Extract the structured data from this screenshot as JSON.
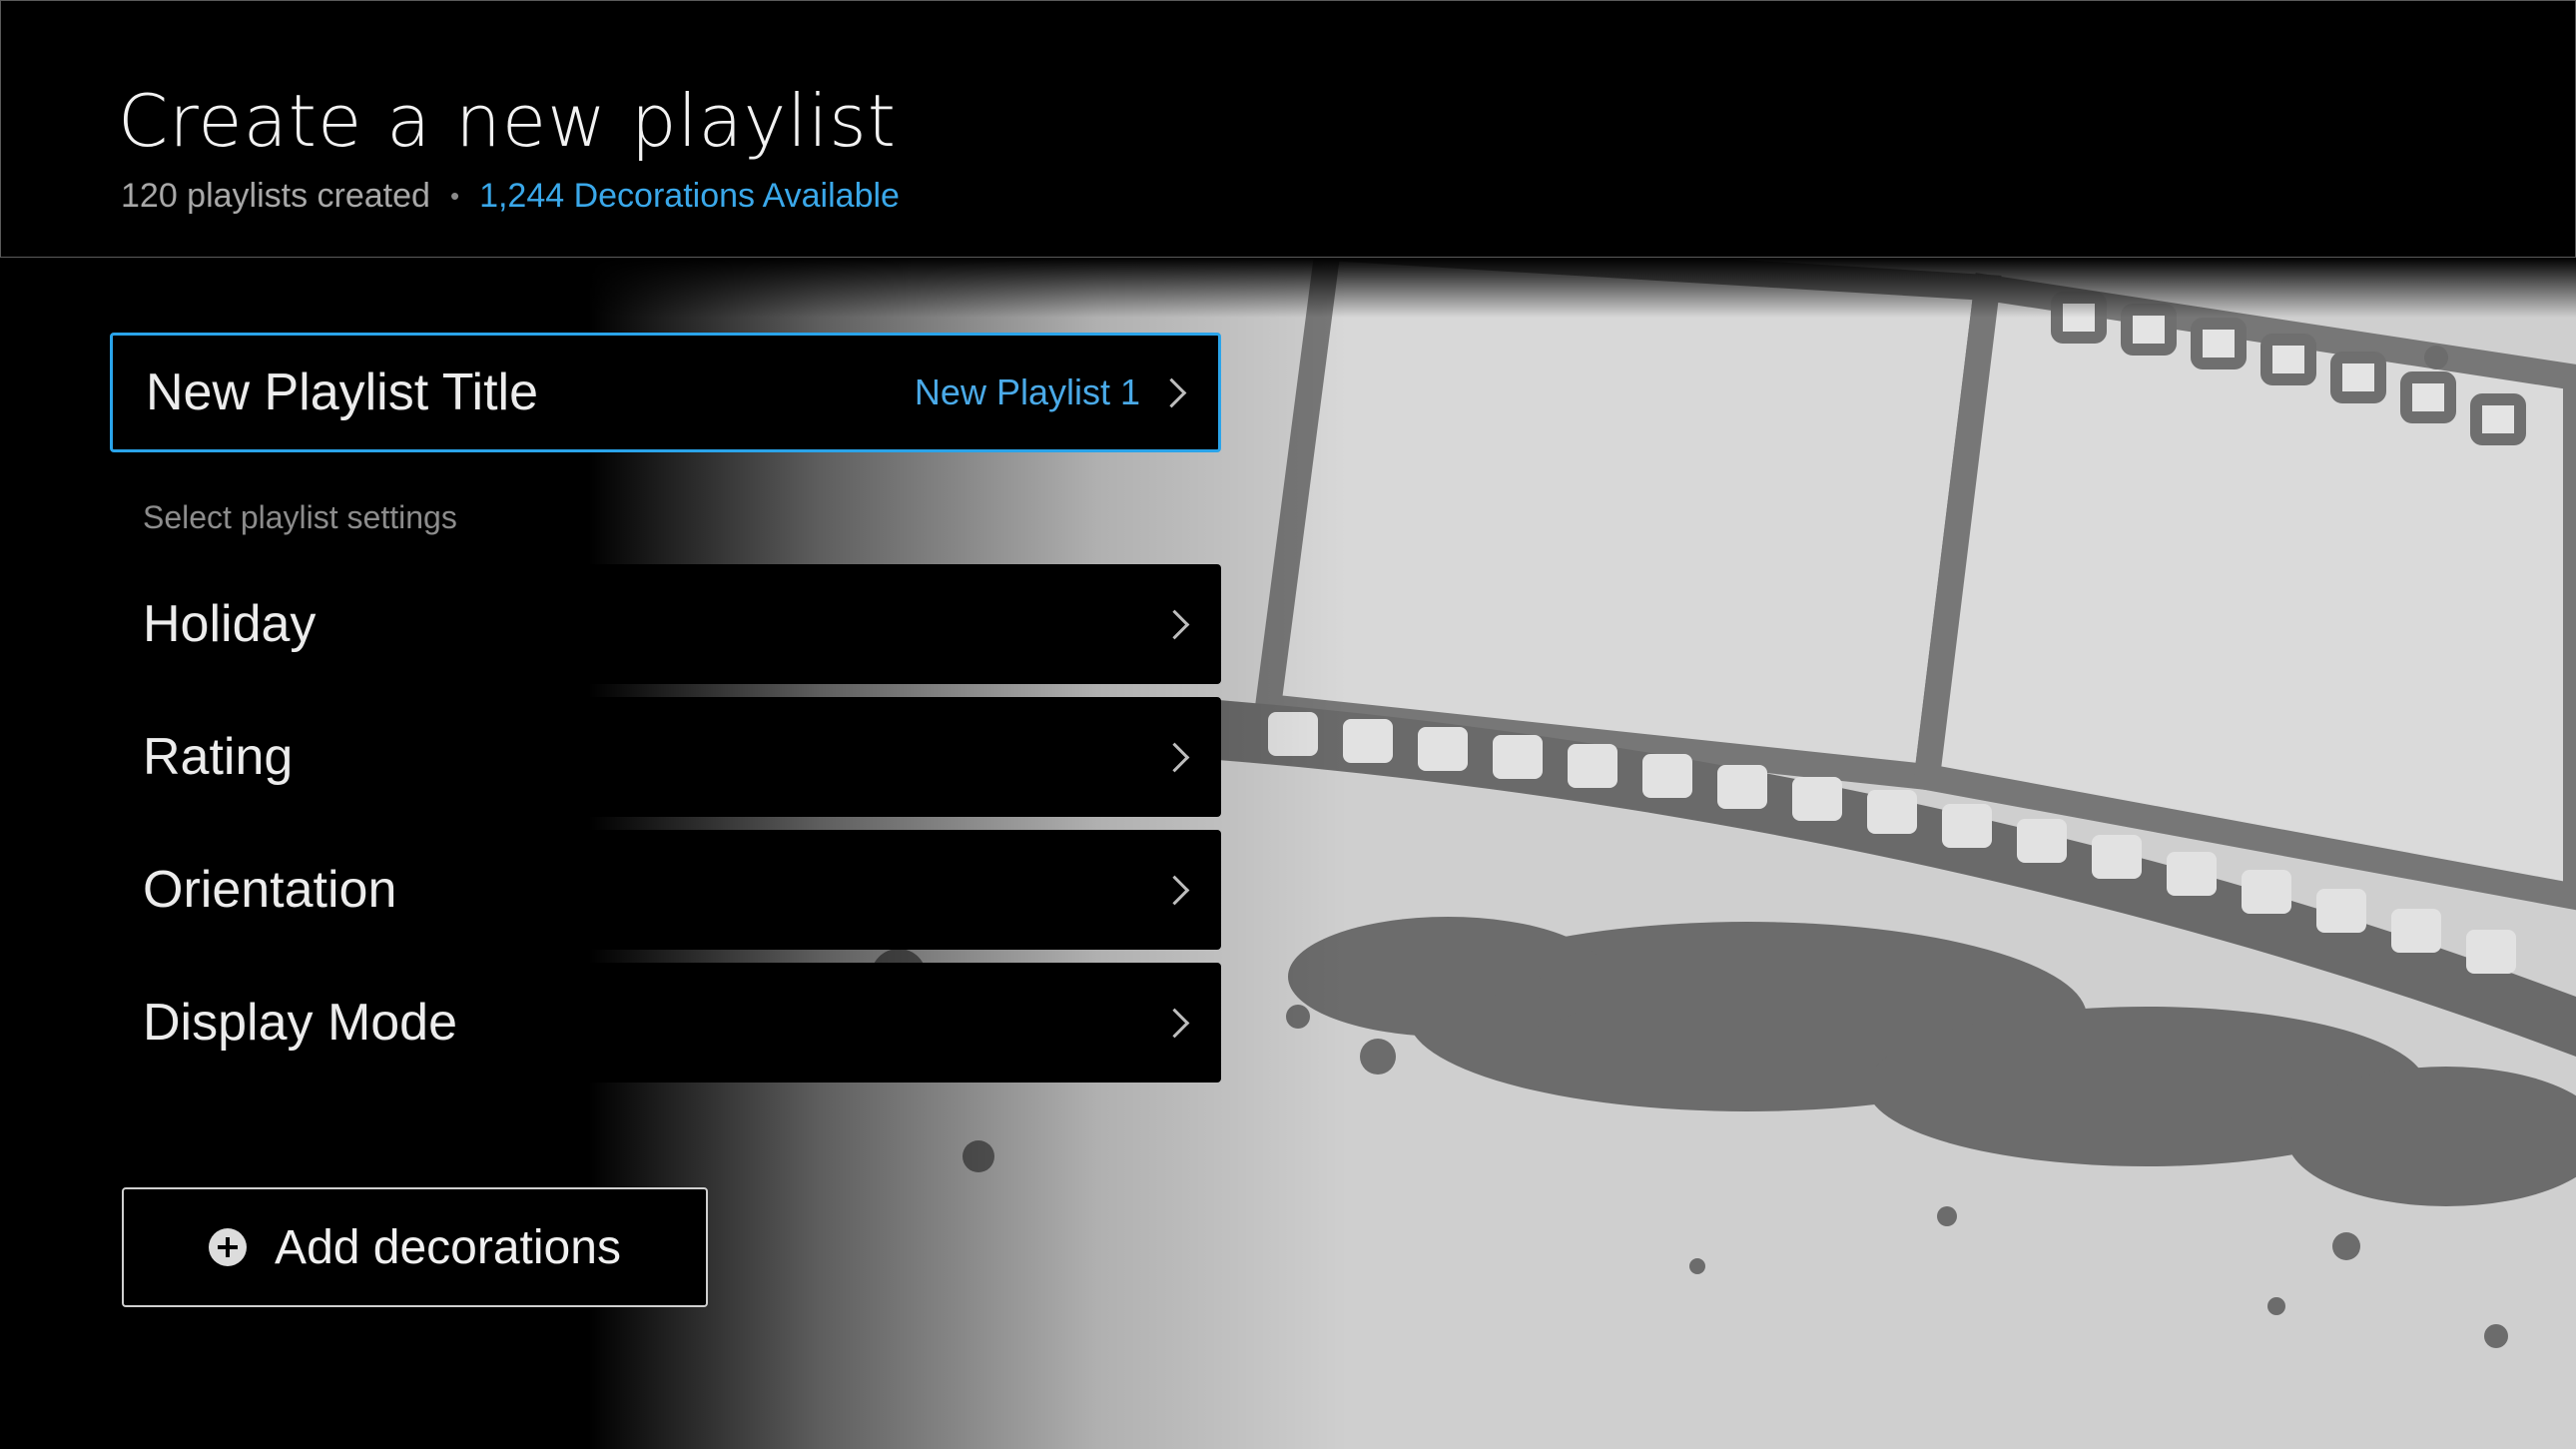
{
  "header": {
    "title": "Create a new playlist",
    "playlist_count": "120 playlists created",
    "separator": "•",
    "decorations_available": "1,244 Decorations Available"
  },
  "title_row": {
    "label": "New Playlist Title",
    "value": "New Playlist 1"
  },
  "settings": {
    "section_label": "Select playlist settings",
    "items": [
      {
        "label": "Holiday"
      },
      {
        "label": "Rating"
      },
      {
        "label": "Orientation"
      },
      {
        "label": "Display Mode"
      }
    ]
  },
  "add_button": {
    "label": "Add decorations"
  },
  "colors": {
    "accent": "#2aa4ea",
    "background": "#000000",
    "secondary_text": "#a8a8a8"
  }
}
